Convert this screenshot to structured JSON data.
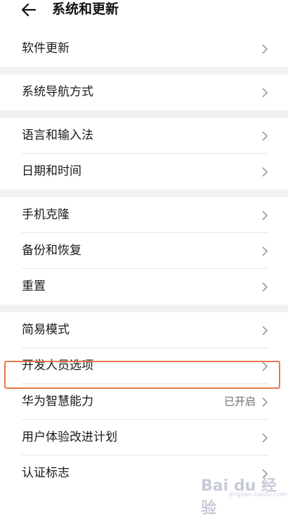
{
  "header": {
    "title": "系统和更新",
    "back_icon": "arrow-left-icon"
  },
  "groups": [
    {
      "items": [
        {
          "label": "软件更新",
          "value": ""
        }
      ]
    },
    {
      "items": [
        {
          "label": "系统导航方式",
          "value": ""
        }
      ]
    },
    {
      "items": [
        {
          "label": "语言和输入法",
          "value": ""
        },
        {
          "label": "日期和时间",
          "value": ""
        }
      ]
    },
    {
      "items": [
        {
          "label": "手机克隆",
          "value": ""
        },
        {
          "label": "备份和恢复",
          "value": ""
        },
        {
          "label": "重置",
          "value": ""
        }
      ]
    },
    {
      "items": [
        {
          "label": "简易模式",
          "value": ""
        },
        {
          "label": "开发人员选项",
          "value": ""
        },
        {
          "label": "华为智慧能力",
          "value": "已开启"
        },
        {
          "label": "用户体验改进计划",
          "value": ""
        },
        {
          "label": "认证标志",
          "value": ""
        }
      ]
    }
  ],
  "highlight_color": "#e8784a",
  "watermark": {
    "text": "Bai du 经验",
    "sub": "jingyan.baidu.com"
  }
}
